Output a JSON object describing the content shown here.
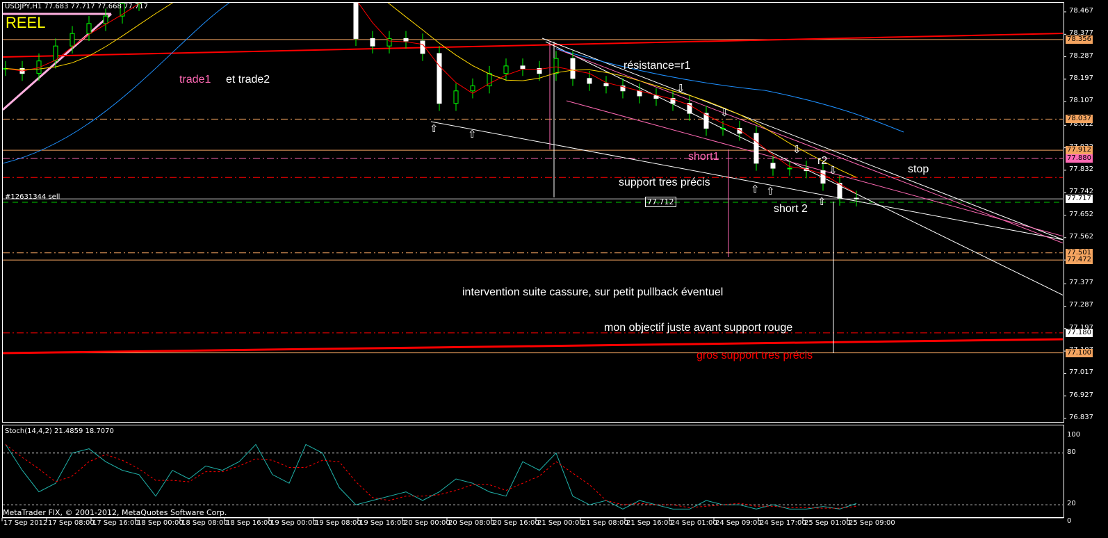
{
  "header": {
    "symbol_info": "USDJPY,H1  77.683 77.717 77.668 77.717",
    "account_type": "REEL"
  },
  "footer": {
    "copyright": "MetaTrader FIX, © 2001-2012, MetaQuotes Software Corp."
  },
  "order": {
    "label": "#12631344 sell",
    "price_box": "77.712"
  },
  "annotations": {
    "trade1": "trade1",
    "trade2": "et trade2",
    "resistance": "résistance=r1",
    "short1": "short1",
    "r2": "r2",
    "stop": "stop",
    "support": "support tres précis",
    "short2": "short 2",
    "intervention": "intervention suite cassure, sur petit pullback éventuel",
    "objective": "mon objectif juste avant support rouge",
    "big_support": "gros support tres précis"
  },
  "colors": {
    "bull": "#00ff00",
    "bear": "#ffffff",
    "ma_fast": "#ff0000",
    "ma_slow": "#ffd700",
    "stoch_main": "#20b2aa",
    "stoch_signal": "#ff0000",
    "level_orange": "#f4a460",
    "level_pink": "#ff69b4",
    "support_red": "#ff0000"
  },
  "chart_data": [
    {
      "type": "candlestick",
      "title": "USDJPY,H1",
      "ylim": [
        76.837,
        78.467
      ],
      "y_ticks": [
        "78.467",
        "78.377",
        "78.287",
        "78.197",
        "78.107",
        "78.012",
        "77.922",
        "77.832",
        "77.742",
        "77.652",
        "77.562",
        "77.472",
        "77.377",
        "77.287",
        "77.197",
        "77.107",
        "77.017",
        "76.927",
        "76.837"
      ],
      "x_ticks": [
        "17 Sep 2012",
        "17 Sep 08:00",
        "17 Sep 16:00",
        "18 Sep 00:00",
        "18 Sep 08:00",
        "18 Sep 16:00",
        "19 Sep 00:00",
        "19 Sep 08:00",
        "19 Sep 16:00",
        "20 Sep 00:00",
        "20 Sep 08:00",
        "20 Sep 16:00",
        "21 Sep 00:00",
        "21 Sep 08:00",
        "21 Sep 16:00",
        "24 Sep 01:00",
        "24 Sep 09:00",
        "24 Sep 17:00",
        "25 Sep 01:00",
        "25 Sep 09:00"
      ],
      "bars_per_sample": 3,
      "closes": [
        78.24,
        78.22,
        78.27,
        78.33,
        78.38,
        78.42,
        78.45,
        78.5,
        78.55,
        78.6,
        78.62,
        78.63,
        78.62,
        78.6,
        78.61,
        78.63,
        78.64,
        78.62,
        78.6,
        78.61,
        78.58,
        78.36,
        78.33,
        78.36,
        78.35,
        78.3,
        78.1,
        78.15,
        78.17,
        78.22,
        78.25,
        78.24,
        78.22,
        78.28,
        78.2,
        78.18,
        78.17,
        78.15,
        78.13,
        78.12,
        78.1,
        78.06,
        78.0,
        78.0,
        77.98,
        77.86,
        77.84,
        77.84,
        77.83,
        77.78,
        77.72,
        77.717
      ],
      "levels": [
        {
          "price": "78.356",
          "style": "solid",
          "color": "#f4a460"
        },
        {
          "price": "78.037",
          "style": "dashdot",
          "color": "#f4a460"
        },
        {
          "price": "77.912",
          "style": "solid",
          "color": "#f4a460"
        },
        {
          "price": "77.880",
          "style": "dashdot",
          "color": "#ff69b4"
        },
        {
          "price": "77.803",
          "style": "dashdot",
          "color": "#ff0000"
        },
        {
          "price": "77.717",
          "style": "solid",
          "color": "#c0c0c0"
        },
        {
          "price": "77.501",
          "style": "dashdot",
          "color": "#f4a460"
        },
        {
          "price": "77.472",
          "style": "solid",
          "color": "#f4a460"
        },
        {
          "price": "77.180",
          "style": "dashdot",
          "color": "#ff0000"
        },
        {
          "price": "77.100",
          "style": "solid",
          "color": "#f4a460"
        }
      ],
      "price_labels": [
        "78.356",
        "78.037",
        "77.912",
        "77.880",
        "77.717",
        "77.501",
        "77.472",
        "77.180",
        "77.100"
      ]
    },
    {
      "type": "line",
      "title": "Stoch(14,4,2) 21.4859 18.7070",
      "ylim": [
        0,
        100
      ],
      "y_ticks": [
        "100",
        "80",
        "20",
        "0"
      ],
      "k_values": [
        90,
        60,
        35,
        45,
        80,
        85,
        70,
        60,
        55,
        30,
        60,
        50,
        65,
        60,
        70,
        90,
        55,
        45,
        90,
        80,
        40,
        20,
        25,
        30,
        35,
        25,
        35,
        50,
        45,
        35,
        30,
        70,
        60,
        80,
        30,
        20,
        25,
        15,
        25,
        20,
        15,
        15,
        25,
        20,
        20,
        15,
        20,
        15,
        15,
        18,
        15,
        21.4859
      ],
      "d_last": 18.707
    }
  ]
}
